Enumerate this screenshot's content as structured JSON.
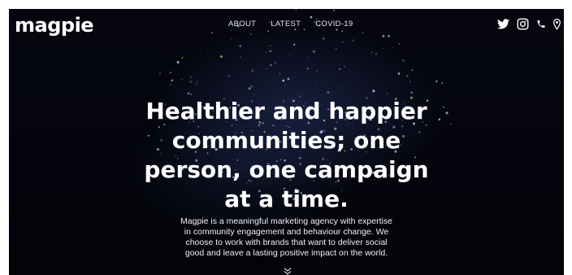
{
  "header": {
    "logo": "magpie",
    "nav": [
      "ABOUT",
      "LATEST",
      "COVID-19"
    ],
    "social_icons": [
      "twitter-icon",
      "instagram-icon",
      "phone-icon",
      "location-pin-icon"
    ]
  },
  "hero": {
    "title_lines": [
      "Healthier and happier",
      "communities; one",
      "person, one campaign",
      "at a time."
    ],
    "text_lines": [
      "Magpie is a meaningful marketing agency with expertise",
      "in community engagement and behaviour change. We",
      "choose to work with brands that want to deliver social",
      "good and leave a lasting positive impact on the world."
    ],
    "scroll_icon": "chevron-down-icon"
  },
  "colors": {
    "background": "#04050d",
    "text": "#ffffff",
    "glow": "#3c5096"
  }
}
